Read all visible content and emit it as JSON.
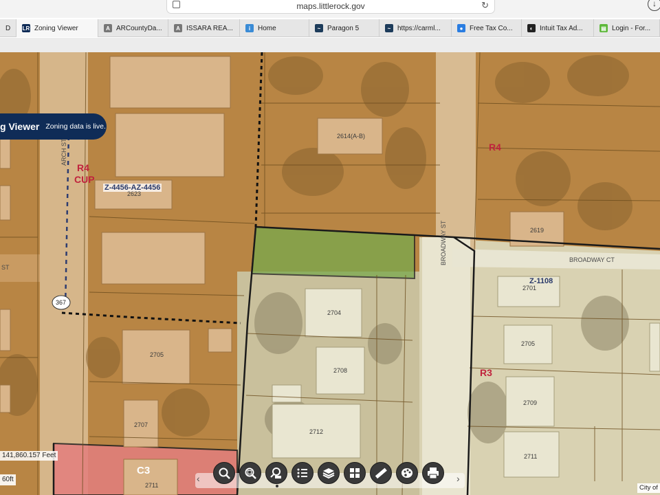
{
  "browser": {
    "url": "maps.littlerock.gov",
    "tabs": [
      {
        "label": "D",
        "favicon": "letter-d-icon",
        "color": "#555555"
      },
      {
        "label": "Zoning Viewer",
        "favicon": "lr-logo-icon",
        "color": "#0f2c57",
        "active": true
      },
      {
        "label": "ARCountyDa...",
        "favicon": "letter-a-icon",
        "color": "#777777"
      },
      {
        "label": "ISSARA REA...",
        "favicon": "letter-a-icon",
        "color": "#777777"
      },
      {
        "label": "Home",
        "favicon": "info-icon",
        "color": "#3a8bd6"
      },
      {
        "label": "Paragon 5",
        "favicon": "paragon-icon",
        "color": "#1c3b5a"
      },
      {
        "label": "https://carml...",
        "favicon": "paragon-icon",
        "color": "#1c3b5a"
      },
      {
        "label": "Free Tax Co...",
        "favicon": "globe-icon",
        "color": "#2a7de1"
      },
      {
        "label": "Intuit Tax Ad...",
        "favicon": "intuit-icon",
        "color": "#222222"
      },
      {
        "label": "Login - For...",
        "favicon": "document-icon",
        "color": "#5db83a"
      }
    ]
  },
  "app": {
    "title": "g Viewer",
    "live_notice": "Zoning data is live."
  },
  "map": {
    "zones": [
      {
        "label": "R4",
        "color": "#c0233d"
      },
      {
        "label": "CUP",
        "color": "#c0233d"
      },
      {
        "label": "R3",
        "color": "#c0233d"
      },
      {
        "label": "C3",
        "color": "#ffffff"
      }
    ],
    "case_labels": [
      "Z-4456-AZ-4456",
      "Z-1108"
    ],
    "streets": [
      "BROADWAY CT",
      "BROADWAY ST",
      "ST",
      "ARCH ST"
    ],
    "route_shield": "367",
    "addresses": [
      "2614(A-B)",
      "2619",
      "2623",
      "2704",
      "2705",
      "2707",
      "2708",
      "2712",
      "2709",
      "2711",
      "2701",
      "2705",
      "2711"
    ],
    "scale_readout": "141,860.157 Feet",
    "scale_bar": "60ft",
    "attribution": "City of"
  },
  "toolbar": {
    "tools": [
      "search-icon",
      "zoom-search-icon",
      "identify-icon",
      "list-icon",
      "layers-icon",
      "basemap-grid-icon",
      "measure-icon",
      "palette-icon",
      "print-icon"
    ]
  },
  "colors": {
    "residential_overlay": "#c98a3e",
    "r3_overlay": "#ecebd7",
    "commercial_overlay": "#e37e7e",
    "selected_parcel": "#79a94c",
    "header_navy": "#0f2c57"
  }
}
